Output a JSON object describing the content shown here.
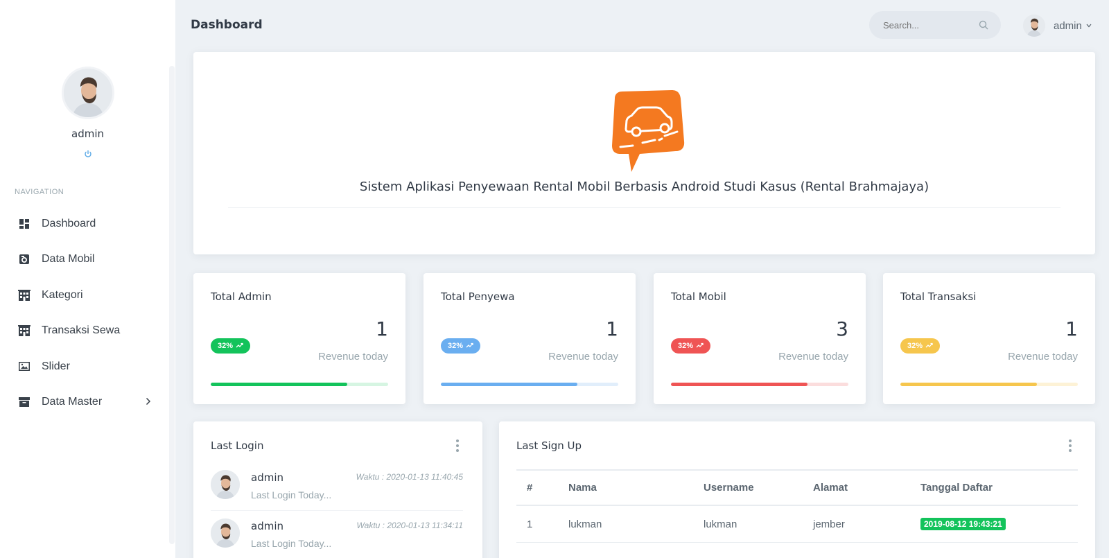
{
  "sidebar": {
    "profile_name": "admin",
    "nav_heading": "NAVIGATION",
    "items": [
      {
        "label": "Dashboard",
        "icon": "dashboard-icon"
      },
      {
        "label": "Data Mobil",
        "icon": "car-icon"
      },
      {
        "label": "Kategori",
        "icon": "building-icon"
      },
      {
        "label": "Transaksi Sewa",
        "icon": "building-icon"
      },
      {
        "label": "Slider",
        "icon": "image-icon"
      },
      {
        "label": "Data Master",
        "icon": "archive-icon"
      }
    ]
  },
  "header": {
    "title": "Dashboard",
    "search_placeholder": "Search...",
    "user_name": "admin"
  },
  "banner": {
    "title": "Sistem Aplikasi Penyewaan Rental Mobil Berbasis Android Studi Kasus (Rental Brahmajaya)",
    "logo_color": "#f47920"
  },
  "stats": [
    {
      "title": "Total Admin",
      "value": "1",
      "sub": "Revenue today",
      "badge": "32%",
      "color": "#13c35b",
      "track": "#d6f5e2",
      "progress": 0.77
    },
    {
      "title": "Total Penyewa",
      "value": "1",
      "sub": "Revenue today",
      "badge": "32%",
      "color": "#6aaef0",
      "track": "#e1eefb",
      "progress": 0.77
    },
    {
      "title": "Total Mobil",
      "value": "3",
      "sub": "Revenue today",
      "badge": "32%",
      "color": "#ef5454",
      "track": "#fbdddd",
      "progress": 0.77
    },
    {
      "title": "Total Transaksi",
      "value": "1",
      "sub": "Revenue today",
      "badge": "32%",
      "color": "#f6c64d",
      "track": "#fdf2d6",
      "progress": 0.77
    }
  ],
  "last_login": {
    "title": "Last Login",
    "items": [
      {
        "name": "admin",
        "sub": "Last Login Today...",
        "time": "Waktu : 2020-01-13 11:40:45"
      },
      {
        "name": "admin",
        "sub": "Last Login Today...",
        "time": "Waktu : 2020-01-13 11:34:11"
      }
    ]
  },
  "last_signup": {
    "title": "Last Sign Up",
    "columns": [
      "#",
      "Nama",
      "Username",
      "Alamat",
      "Tanggal Daftar"
    ],
    "rows": [
      [
        "1",
        "lukman",
        "lukman",
        "jember",
        "2019-08-12 19:43:21"
      ]
    ]
  }
}
